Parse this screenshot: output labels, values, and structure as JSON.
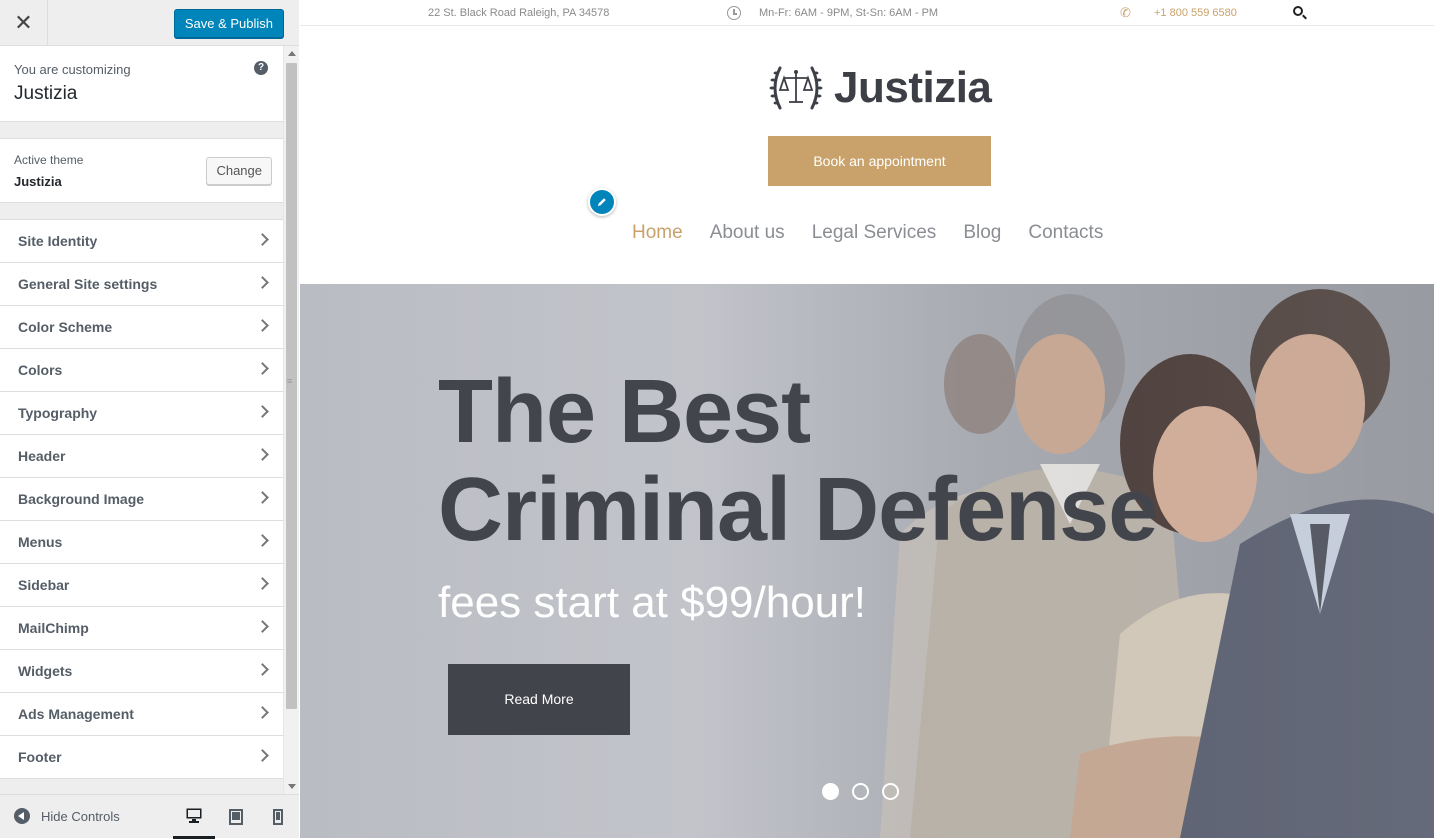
{
  "customizer": {
    "save_label": "Save & Publish",
    "customizing_label": "You are customizing",
    "site_name": "Justizia",
    "active_theme_label": "Active theme",
    "active_theme": "Justizia",
    "change_label": "Change",
    "panels": [
      {
        "label": "Site Identity"
      },
      {
        "label": "General Site settings"
      },
      {
        "label": "Color Scheme"
      },
      {
        "label": "Colors"
      },
      {
        "label": "Typography"
      },
      {
        "label": "Header"
      },
      {
        "label": "Background Image"
      },
      {
        "label": "Menus"
      },
      {
        "label": "Sidebar"
      },
      {
        "label": "MailChimp"
      },
      {
        "label": "Widgets"
      },
      {
        "label": "Ads Management"
      },
      {
        "label": "Footer"
      }
    ],
    "hide_controls_label": "Hide Controls",
    "selected_device": "desktop"
  },
  "site": {
    "topbar": {
      "address": "22 St. Black Road Raleigh, PA 34578",
      "hours": "Mn-Fr: 6AM - 9PM, St-Sn: 6AM - PM",
      "phone": "+1 800 559 6580"
    },
    "logo_text": "Justizia",
    "book_label": "Book an appointment",
    "nav": [
      {
        "label": "Home",
        "active": true
      },
      {
        "label": "About us"
      },
      {
        "label": "Legal Services"
      },
      {
        "label": "Blog"
      },
      {
        "label": "Contacts"
      }
    ],
    "hero": {
      "title_line1": "The Best",
      "title_line2": "Criminal Defense",
      "subtitle": "fees start at $99/hour!",
      "button_label": "Read More",
      "slides": 3,
      "active_slide": 1
    }
  },
  "colors": {
    "accent": "#c9a26b",
    "primary_button": "#0085ba",
    "dark": "#42444b"
  }
}
